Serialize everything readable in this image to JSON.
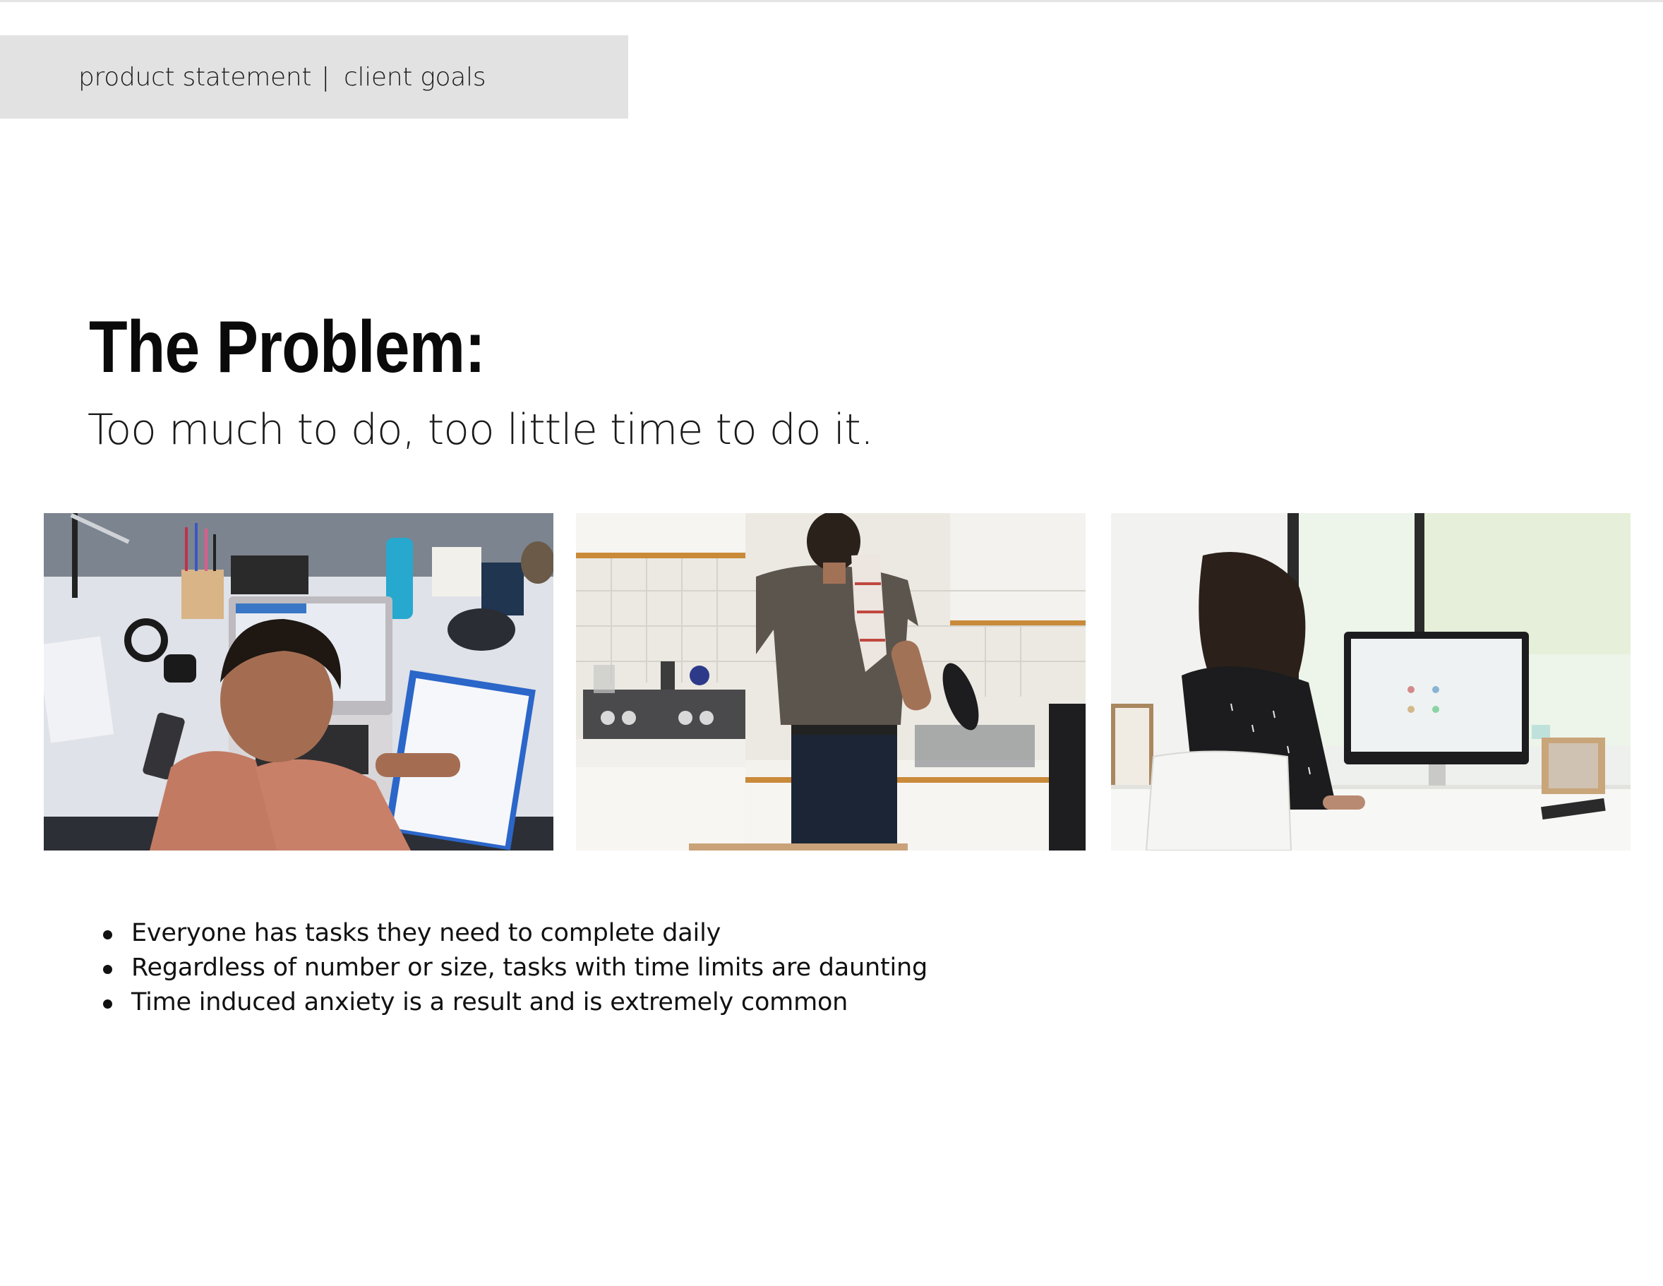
{
  "header": {
    "section_primary": "product statement",
    "separator": "|",
    "section_secondary": "client goals"
  },
  "title": "The Problem:",
  "subtitle": "Too much to do, too little time to do it.",
  "photos": [
    {
      "name": "photo-student-studying"
    },
    {
      "name": "photo-man-washing-dishes"
    },
    {
      "name": "photo-woman-at-computer"
    }
  ],
  "bullets": [
    "Everyone has tasks they need to complete daily",
    "Regardless of number or size, tasks with time limits are daunting",
    "Time induced anxiety is a result and is extremely common"
  ],
  "colors": {
    "tab_background": "#e2e2e2",
    "text": "#111111",
    "background": "#ffffff"
  }
}
